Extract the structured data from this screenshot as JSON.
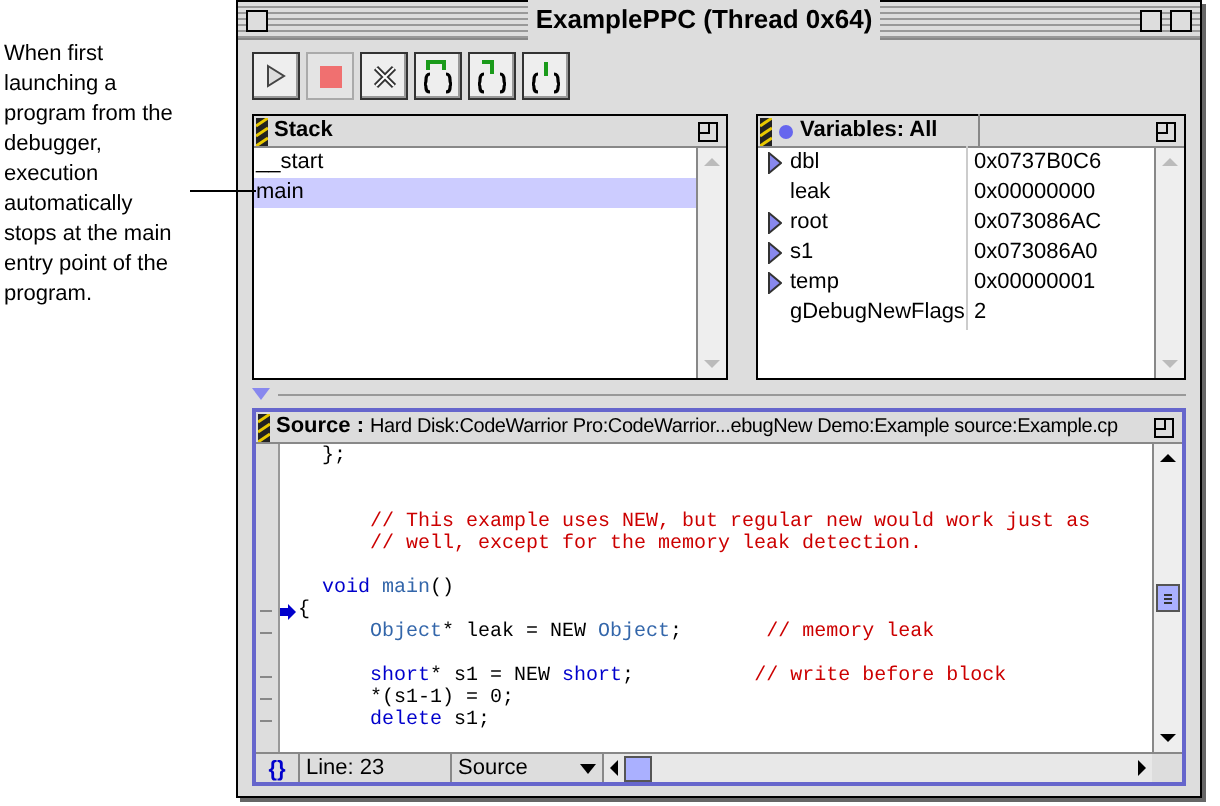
{
  "caption": "When first launching a program from the debugger, execution automatically stops at the main entry point of the program.",
  "window": {
    "title": "ExamplePPC (Thread 0x64)"
  },
  "toolbar": [
    {
      "kind": "run"
    },
    {
      "kind": "stop",
      "disabled": true
    },
    {
      "kind": "kill"
    },
    {
      "kind": "step-over"
    },
    {
      "kind": "step-into"
    },
    {
      "kind": "step-out"
    }
  ],
  "stack": {
    "title": "Stack",
    "items": [
      {
        "label": "__start",
        "selected": false
      },
      {
        "label": "main",
        "selected": true
      }
    ]
  },
  "variables": {
    "title": "Variables: All",
    "rows": [
      {
        "name": "dbl",
        "value": "0x0737B0C6",
        "expandable": true
      },
      {
        "name": "leak",
        "value": "0x00000000",
        "expandable": false
      },
      {
        "name": "root",
        "value": "0x073086AC",
        "expandable": true
      },
      {
        "name": "s1",
        "value": "0x073086A0",
        "expandable": true
      },
      {
        "name": "temp",
        "value": "0x00000001",
        "expandable": true
      },
      {
        "name": "gDebugNewFlags",
        "value": "2",
        "expandable": false
      }
    ]
  },
  "source": {
    "label": "Source :",
    "path": "Hard Disk:CodeWarrior Pro:CodeWarrior...ebugNew Demo:Example source:Example.cp",
    "lines": [
      {
        "marker": false,
        "current": false,
        "tokens": [
          {
            "kind": "plain",
            "text": "  };"
          }
        ]
      },
      {
        "marker": false,
        "current": false
      },
      {
        "marker": false,
        "current": false
      },
      {
        "marker": false,
        "current": false,
        "tokens": [
          {
            "kind": "comment",
            "text": "      // This example uses NEW, but regular new would work just as"
          }
        ]
      },
      {
        "marker": false,
        "current": false,
        "tokens": [
          {
            "kind": "comment",
            "text": "      // well, except for the memory leak detection."
          }
        ]
      },
      {
        "marker": false,
        "current": false
      },
      {
        "marker": false,
        "current": false,
        "tokens": [
          {
            "kind": "keyword",
            "text": "  void"
          },
          {
            "kind": "type",
            "text": " main"
          },
          {
            "kind": "plain",
            "text": "()"
          }
        ]
      },
      {
        "marker": true,
        "current": true,
        "tokens": [
          {
            "kind": "plain",
            "text": "{"
          }
        ]
      },
      {
        "marker": true,
        "current": false,
        "tokens": [
          {
            "kind": "type",
            "text": "      Object"
          },
          {
            "kind": "plain",
            "text": "* leak = NEW "
          },
          {
            "kind": "type",
            "text": "Object"
          },
          {
            "kind": "plain",
            "text": ";       "
          },
          {
            "kind": "comment",
            "text": "// memory leak"
          }
        ]
      },
      {
        "marker": false,
        "current": false
      },
      {
        "marker": true,
        "current": false,
        "tokens": [
          {
            "kind": "keyword",
            "text": "      short"
          },
          {
            "kind": "plain",
            "text": "* s1 = NEW "
          },
          {
            "kind": "keyword",
            "text": "short"
          },
          {
            "kind": "plain",
            "text": ";          "
          },
          {
            "kind": "comment",
            "text": "// write before block"
          }
        ]
      },
      {
        "marker": true,
        "current": false,
        "tokens": [
          {
            "kind": "plain",
            "text": "      *(s1-1) = 0;"
          }
        ]
      },
      {
        "marker": true,
        "current": false,
        "tokens": [
          {
            "kind": "keyword",
            "text": "      delete"
          },
          {
            "kind": "plain",
            "text": " s1;"
          }
        ]
      }
    ]
  },
  "status": {
    "braces": "{}",
    "line": "Line: 23",
    "view": "Source"
  }
}
